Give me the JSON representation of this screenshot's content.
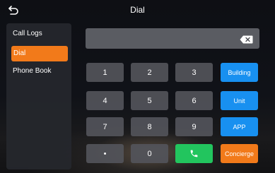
{
  "header": {
    "title": "Dial",
    "back_icon": "back-arrow-icon"
  },
  "sidebar": {
    "items": [
      {
        "label": "Call Logs",
        "active": false
      },
      {
        "label": "Dial",
        "active": true
      },
      {
        "label": "Phone Book",
        "active": false
      }
    ]
  },
  "display": {
    "value": "",
    "backspace_icon": "backspace-icon"
  },
  "keypad": {
    "digits": [
      "1",
      "2",
      "3",
      "4",
      "5",
      "6",
      "7",
      "8",
      "9",
      "•",
      "0"
    ],
    "call_icon": "phone-icon"
  },
  "functions": {
    "building": "Building",
    "unit": "Unit",
    "app": "APP",
    "concierge": "Concierge"
  },
  "colors": {
    "accent_orange": "#f27a1a",
    "function_blue": "#1890f0",
    "call_green": "#22c55e",
    "key_gray": "#52545a"
  }
}
